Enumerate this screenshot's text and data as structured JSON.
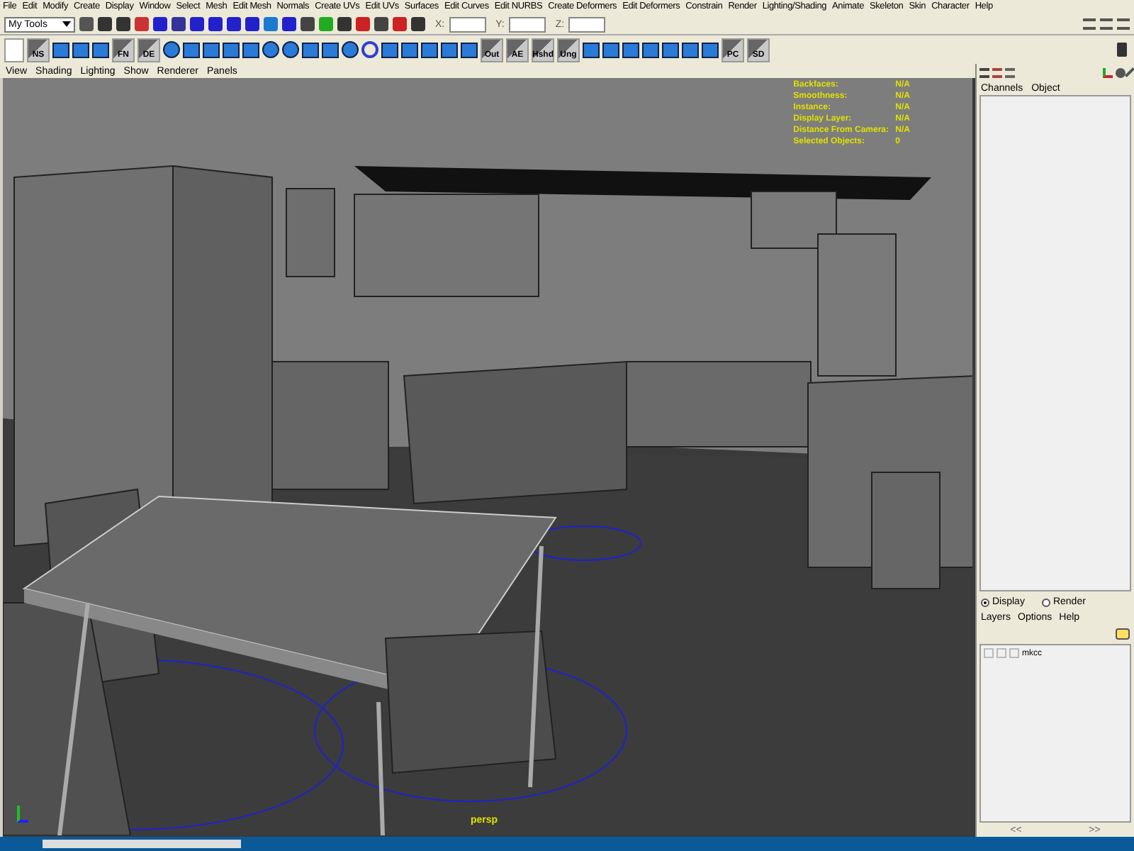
{
  "menu_bar": [
    "File",
    "Edit",
    "Modify",
    "Create",
    "Display",
    "Window",
    "Select",
    "Mesh",
    "Edit Mesh",
    "Normals",
    "Create UVs",
    "Edit UVs",
    "Surfaces",
    "Edit Curves",
    "Edit NURBS",
    "Create Deformers",
    "Edit Deformers",
    "Constrain",
    "Render",
    "Lighting/Shading",
    "Animate",
    "Skeleton",
    "Skin",
    "Character",
    "Help"
  ],
  "status_line": {
    "menu_set": "My Tools",
    "fields": [
      {
        "label": "X:"
      },
      {
        "label": "Y:"
      },
      {
        "label": "Z:"
      }
    ]
  },
  "shelf": {
    "buttons": [
      {
        "kind": "label",
        "text": "NS"
      },
      {
        "kind": "icon"
      },
      {
        "kind": "icon"
      },
      {
        "kind": "icon"
      },
      {
        "kind": "label",
        "text": "FN"
      },
      {
        "kind": "label",
        "text": "DE"
      },
      {
        "kind": "icon"
      },
      {
        "kind": "icon"
      },
      {
        "kind": "icon"
      },
      {
        "kind": "icon"
      },
      {
        "kind": "icon"
      },
      {
        "kind": "icon"
      },
      {
        "kind": "icon"
      },
      {
        "kind": "icon"
      },
      {
        "kind": "icon"
      },
      {
        "kind": "icon"
      },
      {
        "kind": "icon"
      },
      {
        "kind": "icon"
      },
      {
        "kind": "icon"
      },
      {
        "kind": "icon"
      },
      {
        "kind": "icon"
      },
      {
        "kind": "icon"
      },
      {
        "kind": "label",
        "text": "Out"
      },
      {
        "kind": "label",
        "text": "AE"
      },
      {
        "kind": "label",
        "text": "Hshd"
      },
      {
        "kind": "label",
        "text": "Ung"
      },
      {
        "kind": "icon"
      },
      {
        "kind": "icon"
      },
      {
        "kind": "icon"
      },
      {
        "kind": "icon"
      },
      {
        "kind": "icon"
      },
      {
        "kind": "icon"
      },
      {
        "kind": "icon"
      },
      {
        "kind": "label",
        "text": "PC"
      },
      {
        "kind": "label",
        "text": "SD"
      }
    ]
  },
  "viewport": {
    "menus": [
      "View",
      "Shading",
      "Lighting",
      "Show",
      "Renderer",
      "Panels"
    ],
    "hud": [
      {
        "label": "Backfaces:",
        "value": "N/A"
      },
      {
        "label": "Smoothness:",
        "value": "N/A"
      },
      {
        "label": "Instance:",
        "value": "N/A"
      },
      {
        "label": "Display Layer:",
        "value": "N/A"
      },
      {
        "label": "Distance From Camera:",
        "value": "N/A"
      },
      {
        "label": "Selected Objects:",
        "value": "0"
      }
    ],
    "camera": "persp"
  },
  "channel_box": {
    "menus": [
      "Channels",
      "Object"
    ]
  },
  "layer_editor": {
    "modes": [
      {
        "label": "Display",
        "selected": true
      },
      {
        "label": "Render",
        "selected": false
      }
    ],
    "menus": [
      "Layers",
      "Options",
      "Help"
    ],
    "layers": [
      {
        "name": "mkcc"
      }
    ],
    "nav": [
      "<<",
      ">>"
    ]
  }
}
